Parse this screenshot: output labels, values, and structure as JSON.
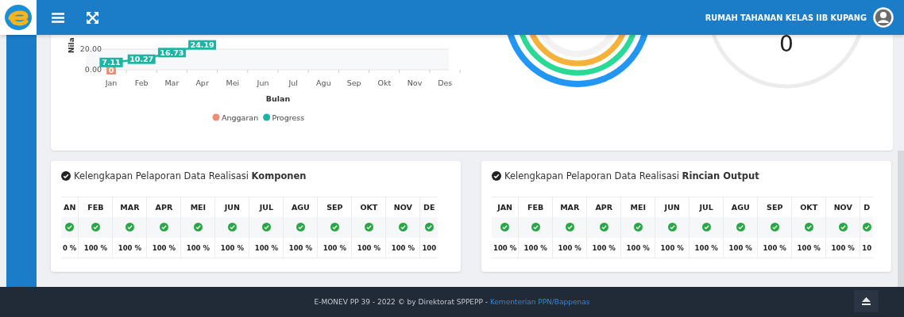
{
  "header": {
    "title": "RUMAH TAHANAN KELAS IIB KUPANG"
  },
  "summary": {
    "chart_data": {
      "type": "line",
      "xlabel": "Bulan",
      "ylabel": "Nila",
      "categories": [
        "Jan",
        "Feb",
        "Mar",
        "Apr",
        "Mei",
        "Jun",
        "Jul",
        "Agu",
        "Sep",
        "Okt",
        "Nov",
        "Des"
      ],
      "ylim": [
        0,
        34
      ],
      "yticks": [
        {
          "value": 0,
          "label": "0.00"
        },
        {
          "value": 20,
          "label": "20.00"
        }
      ],
      "data_labels": true,
      "legend": true,
      "bands": [
        {
          "axis": "y",
          "from": 0,
          "to": 20
        }
      ],
      "series": [
        {
          "name": "Anggaran",
          "color": "#f28b74",
          "marker": "square",
          "values": [
            0,
            null,
            null,
            null,
            null,
            null,
            null,
            null,
            null,
            null,
            null,
            null
          ]
        },
        {
          "name": "Progress",
          "color": "#1cb5a3",
          "marker": "square",
          "values": [
            7.11,
            10.27,
            16.73,
            24.19,
            null,
            null,
            null,
            null,
            null,
            null,
            null,
            null
          ]
        }
      ]
    },
    "gauge": {
      "value": "0"
    }
  },
  "reports": [
    {
      "title": "Kelengkapan Pelaporan Data Realisasi **Komponen**",
      "columns": [
        {
          "month": "AN",
          "complete": true,
          "percent": "0 %"
        },
        {
          "month": "FEB",
          "complete": true,
          "percent": "100 %"
        },
        {
          "month": "MAR",
          "complete": true,
          "percent": "100 %"
        },
        {
          "month": "APR",
          "complete": true,
          "percent": "100 %"
        },
        {
          "month": "MEI",
          "complete": true,
          "percent": "100 %"
        },
        {
          "month": "JUN",
          "complete": true,
          "percent": "100 %"
        },
        {
          "month": "JUL",
          "complete": true,
          "percent": "100 %"
        },
        {
          "month": "AGU",
          "complete": true,
          "percent": "100 %"
        },
        {
          "month": "SEP",
          "complete": true,
          "percent": "100 %"
        },
        {
          "month": "OKT",
          "complete": true,
          "percent": "100 %"
        },
        {
          "month": "NOV",
          "complete": true,
          "percent": "100 %"
        },
        {
          "month": "DE",
          "complete": true,
          "percent": "100"
        }
      ]
    },
    {
      "title": "Kelengkapan Pelaporan Data Realisasi **Rincian Output**",
      "columns": [
        {
          "month": "JAN",
          "complete": true,
          "percent": "100 %"
        },
        {
          "month": "FEB",
          "complete": true,
          "percent": "100 %"
        },
        {
          "month": "MAR",
          "complete": true,
          "percent": "100 %"
        },
        {
          "month": "APR",
          "complete": true,
          "percent": "100 %"
        },
        {
          "month": "MEI",
          "complete": true,
          "percent": "100 %"
        },
        {
          "month": "JUN",
          "complete": true,
          "percent": "100 %"
        },
        {
          "month": "JUL",
          "complete": true,
          "percent": "100 %"
        },
        {
          "month": "AGU",
          "complete": true,
          "percent": "100 %"
        },
        {
          "month": "SEP",
          "complete": true,
          "percent": "100 %"
        },
        {
          "month": "OKT",
          "complete": true,
          "percent": "100 %"
        },
        {
          "month": "NOV",
          "complete": true,
          "percent": "100 %"
        },
        {
          "month": "D",
          "complete": true,
          "percent": "10"
        }
      ]
    }
  ],
  "footer": {
    "text": "E-MONEV PP 39 - 2022 © by Direktorat SPPEPP -",
    "link": "Kementerian PPN/Bappenas"
  }
}
